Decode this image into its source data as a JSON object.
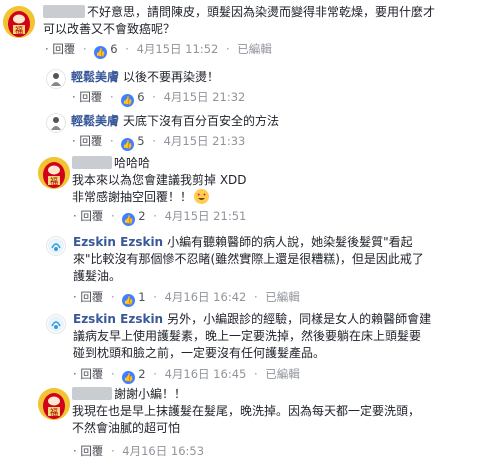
{
  "comments": [
    {
      "text_line1": "不好意思，請問陳皮，頭髮因為染燙而變得非常乾燥，要用什麼才",
      "text_line2": "可以改善又不會致癌呢？",
      "reply": "回覆",
      "dot": "·",
      "likes": "6",
      "time": "4月15日 11:52",
      "edited": "已編輯",
      "avatar_text": "福",
      "replies": [
        {
          "author": "輕鬆美膚",
          "text": "以後不要再染燙！",
          "reply": "回覆",
          "likes": "6",
          "time": "4月15日 21:32"
        },
        {
          "author": "輕鬆美膚",
          "text": "天底下沒有百分百安全的方法",
          "reply": "回覆",
          "likes": "5",
          "time": "4月15日 21:33"
        }
      ]
    },
    {
      "name_suffix": "哈哈哈",
      "text_line1": "我本來以為您會建議我剪掉 XDD",
      "text_line2": "非常感謝抽空回覆！！",
      "reply": "回覆",
      "likes": "2",
      "time": "4月15日 21:51",
      "avatar_text": "福"
    },
    {
      "author": "Ezskin Ezskin",
      "text_line1": "小編有聽賴醫師的病人說，她染髮後髮質\"看起",
      "text_line2": "來\"比較沒有那個慘不忍睹(雖然實際上還是很糟糕)，但是因此戒了",
      "text_line3": "護髮油。",
      "reply": "回覆",
      "likes": "1",
      "time": "4月16日 16:42",
      "edited": "已編輯"
    },
    {
      "author": "Ezskin Ezskin",
      "text_line1": "另外，小編跟診的經驗，同樣是女人的賴醫師會建",
      "text_line2": "議病友早上使用護髮素，晚上一定要洗掉，然後要躺在床上頭髮要",
      "text_line3": "碰到枕頭和臉之前，一定要沒有任何護髮產品。",
      "reply": "回覆",
      "likes": "2",
      "time": "4月16日 16:45",
      "edited": "已編輯"
    },
    {
      "name_suffix": "謝謝小編！！",
      "text_line1": "我現在也是早上抹護髮在髮尾，晚洗掉。因為每天都一定要洗頭，",
      "text_line2": "不然會油膩的超可怕",
      "reply": "回覆",
      "time": "4月16日 16:53",
      "avatar_text": "福"
    }
  ],
  "colors": {
    "link": "#385898",
    "meta": "#90949c",
    "like": "#4080ff",
    "avatar_red": "#d0021b"
  },
  "icons": {
    "like": "thumbs-up-icon",
    "emoji": "smiling-heart-eyes-icon"
  }
}
